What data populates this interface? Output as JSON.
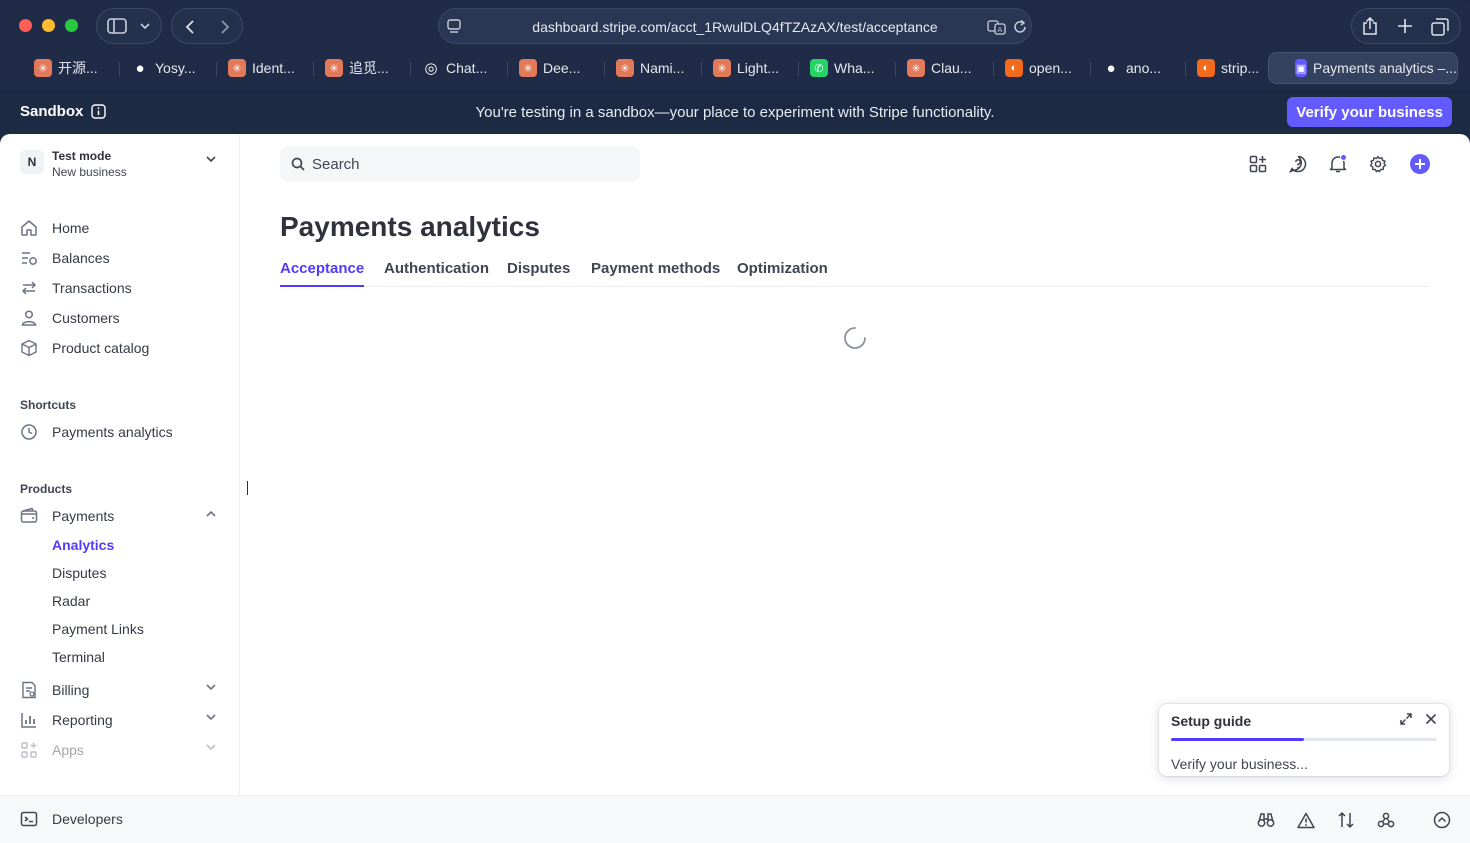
{
  "browser": {
    "url": "dashboard.stripe.com/acct_1RwulDLQ4fTZAzAX/test/acceptance",
    "tabs": [
      {
        "label": "开源...",
        "icon": "claude-icon"
      },
      {
        "label": "Yosy...",
        "icon": "github-icon"
      },
      {
        "label": "Ident...",
        "icon": "claude-icon"
      },
      {
        "label": "追觅...",
        "icon": "claude-icon"
      },
      {
        "label": "Chat...",
        "icon": "openai-icon"
      },
      {
        "label": "Dee...",
        "icon": "claude-icon"
      },
      {
        "label": "Nami...",
        "icon": "claude-icon"
      },
      {
        "label": "Light...",
        "icon": "claude-icon"
      },
      {
        "label": "Wha...",
        "icon": "whatsapp-icon"
      },
      {
        "label": "Clau...",
        "icon": "claude-icon"
      },
      {
        "label": "open...",
        "icon": "firefox-icon"
      },
      {
        "label": "ano...",
        "icon": "github-icon"
      },
      {
        "label": "strip...",
        "icon": "firefox-icon"
      },
      {
        "label": "Payments analytics –...",
        "icon": "stripe-icon"
      }
    ]
  },
  "banner": {
    "sandbox": "Sandbox",
    "message": "You're testing in a sandbox—your place to experiment with Stripe functionality.",
    "verify": "Verify your business"
  },
  "account": {
    "initial": "N",
    "mode": "Test mode",
    "name": "New business"
  },
  "sidebar": {
    "items": [
      {
        "label": "Home",
        "icon": "home-icon"
      },
      {
        "label": "Balances",
        "icon": "balances-icon"
      },
      {
        "label": "Transactions",
        "icon": "transactions-icon"
      },
      {
        "label": "Customers",
        "icon": "customers-icon"
      },
      {
        "label": "Product catalog",
        "icon": "product-catalog-icon"
      }
    ],
    "shortcuts_label": "Shortcuts",
    "shortcuts": [
      {
        "label": "Payments analytics",
        "icon": "clock-icon"
      }
    ],
    "products_label": "Products",
    "payments": "Payments",
    "payments_sub": [
      "Analytics",
      "Disputes",
      "Radar",
      "Payment Links",
      "Terminal"
    ],
    "billing": "Billing",
    "reporting": "Reporting",
    "apps": "Apps"
  },
  "search": {
    "placeholder": "Search"
  },
  "page": {
    "title": "Payments analytics",
    "tabs": [
      "Acceptance",
      "Authentication",
      "Disputes",
      "Payment methods",
      "Optimization"
    ],
    "active_tab": "Acceptance"
  },
  "setup_guide": {
    "title": "Setup guide",
    "progress": 0.5,
    "text": "Verify your business..."
  },
  "footer": {
    "developers": "Developers"
  },
  "colors": {
    "accent": "#533afd",
    "verify_button": "#635bff",
    "chrome": "#1d2a44"
  }
}
